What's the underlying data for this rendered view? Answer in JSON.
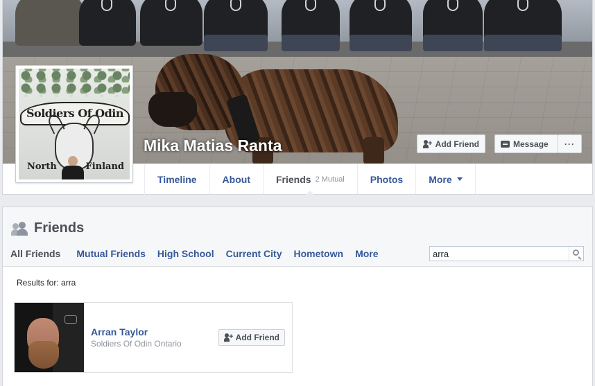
{
  "profile": {
    "name": "Mika Matias Ranta",
    "picture_text": {
      "banner_top": "Soldiers Of Odin",
      "banner_left": "North",
      "banner_right": "Finland"
    },
    "actions": {
      "add_friend": "Add Friend",
      "message": "Message",
      "more": "···"
    }
  },
  "nav": {
    "tabs": [
      {
        "label": "Timeline"
      },
      {
        "label": "About"
      },
      {
        "label": "Friends",
        "badge": "2 Mutual",
        "active": true
      },
      {
        "label": "Photos"
      },
      {
        "label": "More"
      }
    ]
  },
  "friends": {
    "title": "Friends",
    "filters": [
      {
        "label": "All Friends",
        "active": true
      },
      {
        "label": "Mutual Friends"
      },
      {
        "label": "High School"
      },
      {
        "label": "Current City"
      },
      {
        "label": "Hometown"
      },
      {
        "label": "More"
      }
    ],
    "search_value": "arra",
    "results_label": "Results for: arra",
    "results": [
      {
        "name": "Arran Taylor",
        "subtitle": "Soldiers Of Odin Ontario",
        "action": "Add Friend"
      }
    ]
  },
  "colors": {
    "link": "#365899",
    "text": "#4b4f56",
    "muted": "#90949c",
    "page_bg": "#e9ebee"
  }
}
